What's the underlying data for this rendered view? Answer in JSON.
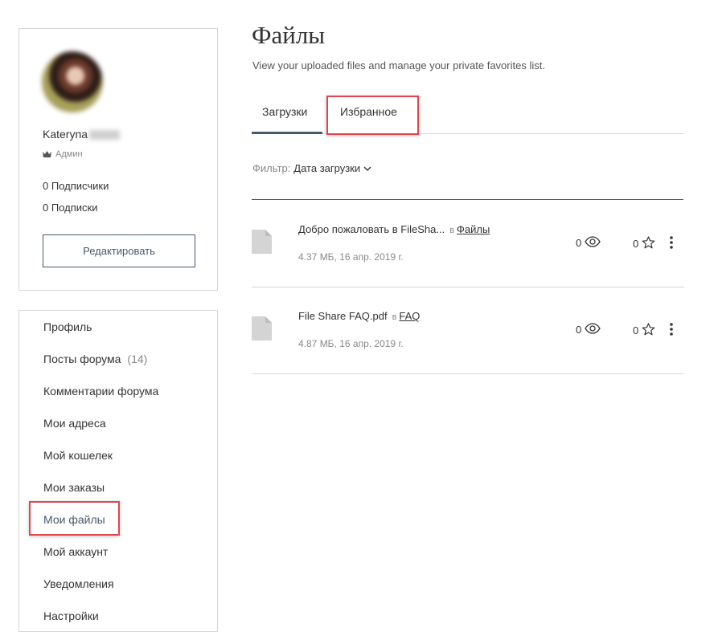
{
  "profile": {
    "name": "Kateryna",
    "role": "Админ",
    "followers": "0 Подписчики",
    "following": "0 Подписки",
    "edit_label": "Редактировать"
  },
  "nav": {
    "items": [
      {
        "label": "Профиль"
      },
      {
        "label": "Посты форума",
        "count": "(14)"
      },
      {
        "label": "Комментарии форума"
      },
      {
        "label": "Мои адреса"
      },
      {
        "label": "Мой кошелек"
      },
      {
        "label": "Мои заказы"
      },
      {
        "label": "Мои файлы"
      },
      {
        "label": "Мой аккаунт"
      },
      {
        "label": "Уведомления"
      },
      {
        "label": "Настройки"
      }
    ]
  },
  "main": {
    "title": "Файлы",
    "subtitle": "View your uploaded files and manage your private favorites list.",
    "tabs": [
      {
        "label": "Загрузки"
      },
      {
        "label": "Избранное"
      }
    ],
    "filter": {
      "label": "Фильтр:",
      "value": "Дата загрузки"
    },
    "files": [
      {
        "name": "Добро пожаловать в FileSha...",
        "in": "в",
        "folder": "Файлы",
        "meta": "4.37 МБ, 16 апр. 2019 г.",
        "views": "0",
        "likes": "0"
      },
      {
        "name": "File Share FAQ.pdf",
        "in": "в",
        "folder": "FAQ",
        "meta": "4.87 МБ, 16 апр. 2019 г.",
        "views": "0",
        "likes": "0"
      }
    ]
  },
  "colors": {
    "accent": "#44596a",
    "highlight": "#e0454f",
    "border": "#d6d6d6"
  }
}
